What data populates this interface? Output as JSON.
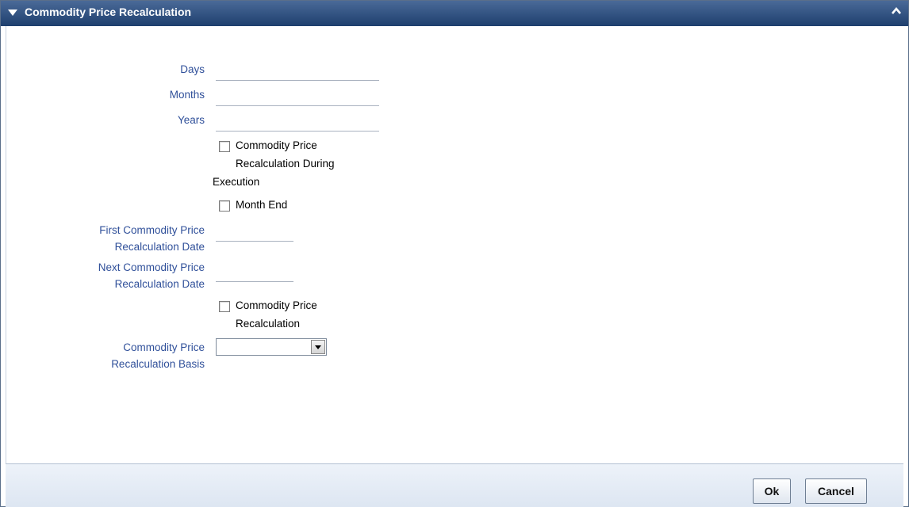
{
  "window": {
    "title": "Commodity Price Recalculation"
  },
  "form": {
    "days_label": "Days",
    "days_value": "",
    "months_label": "Months",
    "months_value": "",
    "years_label": "Years",
    "years_value": "",
    "during_execution_checkbox": {
      "checked": false,
      "label_line1": "Commodity Price",
      "label_line2": "Recalculation During",
      "label_line3": "Execution"
    },
    "month_end_checkbox": {
      "checked": false,
      "label": "Month End"
    },
    "first_date_label_line1": "First Commodity Price",
    "first_date_label_line2": "Recalculation Date",
    "first_date_value": "",
    "next_date_label_line1": "Next Commodity Price",
    "next_date_label_line2": "Recalculation Date",
    "next_date_value": "",
    "recalc_checkbox": {
      "checked": false,
      "label_line1": "Commodity Price",
      "label_line2": "Recalculation"
    },
    "basis_label_line1": "Commodity Price",
    "basis_label_line2": "Recalculation Basis",
    "basis_value": ""
  },
  "footer": {
    "ok_label": "Ok",
    "cancel_label": "Cancel"
  },
  "colors": {
    "label": "#30509a",
    "titlebar": "#2b4c7e"
  },
  "icons": {
    "title_toggle": "triangle-down-icon",
    "title_close": "chevron-up-icon",
    "select_arrow": "triangle-down-icon"
  }
}
